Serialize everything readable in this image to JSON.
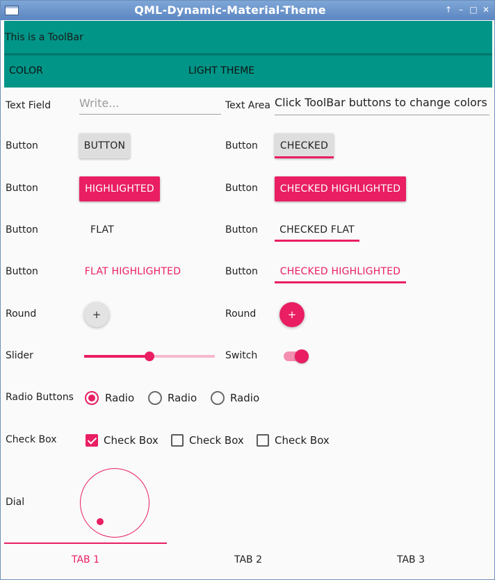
{
  "window": {
    "title": "QML-Dynamic-Material-Theme",
    "controls": [
      "↑",
      "–",
      "□",
      "✕"
    ]
  },
  "toolbar": {
    "label": "This is a ToolBar"
  },
  "toolbar_buttons": {
    "color": "COLOR",
    "theme": "LIGHT THEME"
  },
  "colors": {
    "primary": "#009587",
    "accent": "#e91e63"
  },
  "rows": {
    "text_field": "Text Field",
    "text_area": "Text Area",
    "button": "Button",
    "round": "Round",
    "slider": "Slider",
    "switch": "Switch",
    "radio_buttons": "Radio Buttons",
    "check_box": "Check Box",
    "dial": "Dial"
  },
  "text_field": {
    "placeholder": "Write..."
  },
  "text_area": {
    "value": "Click ToolBar buttons to change colors"
  },
  "buttons": {
    "button": "BUTTON",
    "checked": "CHECKED",
    "highlighted": "HIGHLIGHTED",
    "checked_highlighted": "CHECKED HIGHLIGHTED",
    "flat": "FLAT",
    "checked_flat": "CHECKED FLAT",
    "flat_highlighted": "FLAT HIGHLIGHTED",
    "checked_flat_highlighted": "CHECKED HIGHLIGHTED"
  },
  "round_buttons": {
    "plus": "+"
  },
  "slider": {
    "value": 0.5
  },
  "switch": {
    "checked": true
  },
  "radios": [
    {
      "label": "Radio",
      "checked": true
    },
    {
      "label": "Radio",
      "checked": false
    },
    {
      "label": "Radio",
      "checked": false
    }
  ],
  "checkboxes": [
    {
      "label": "Check Box",
      "checked": true
    },
    {
      "label": "Check Box",
      "checked": false
    },
    {
      "label": "Check Box",
      "checked": false
    }
  ],
  "tabs": [
    {
      "label": "TAB 1",
      "active": true
    },
    {
      "label": "TAB 2",
      "active": false
    },
    {
      "label": "TAB 3",
      "active": false
    }
  ]
}
